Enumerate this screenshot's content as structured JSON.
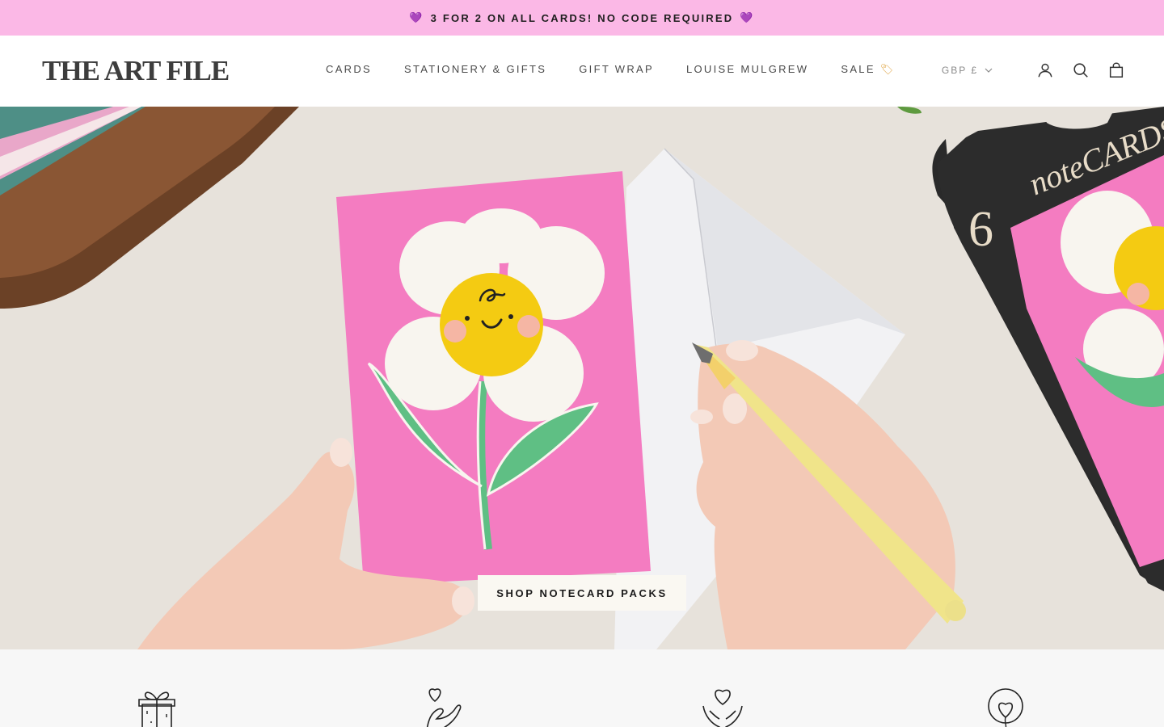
{
  "announcement": {
    "text": "3 FOR 2 ON ALL CARDS! NO CODE REQUIRED",
    "icon": "purple-heart-emoji"
  },
  "header": {
    "logo": "THE ART FILE",
    "nav": [
      {
        "label": "CARDS"
      },
      {
        "label": "STATIONERY & GIFTS"
      },
      {
        "label": "GIFT WRAP"
      },
      {
        "label": "LOUISE MULGREW"
      },
      {
        "label": "SALE",
        "icon": "price-tag-icon"
      }
    ],
    "currency": "GBP £",
    "icons": [
      "account-icon",
      "search-icon",
      "bag-icon"
    ]
  },
  "hero": {
    "button_label": "SHOP NOTECARD PACKS",
    "package_text": "noteCARDS",
    "package_count": "6"
  },
  "features": {
    "icons": [
      "gift-icon",
      "heart-hand-icon",
      "hands-heart-icon",
      "heart-balloon-icon"
    ]
  },
  "colors": {
    "announcement_bg": "#fbb8e6",
    "card_pink": "#f477bf",
    "flower_yellow": "#f2c80f",
    "leaf_green": "#5fbf84",
    "hero_bg": "#e6e1da"
  }
}
